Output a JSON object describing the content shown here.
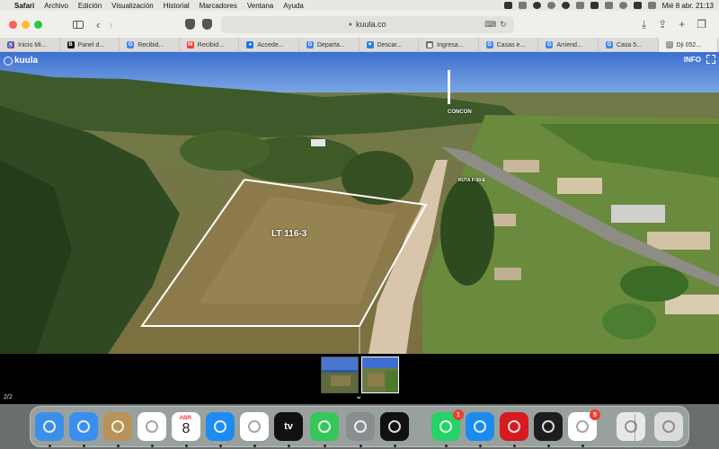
{
  "menubar": {
    "app": "Safari",
    "menus": [
      "Archivo",
      "Edición",
      "Visualización",
      "Historial",
      "Marcadores",
      "Ventana",
      "Ayuda"
    ],
    "datetime": "Mié 8 abr.  21:13"
  },
  "toolbar": {
    "url": "kuula.co"
  },
  "tabs": [
    {
      "label": "Inicio Mi...",
      "favicon_color": "#e0413f",
      "glyph": "♿"
    },
    {
      "label": "Panel d...",
      "favicon_color": "#111111",
      "glyph": "B"
    },
    {
      "label": "Recibid...",
      "favicon_color": "#4285f4",
      "glyph": "G"
    },
    {
      "label": "Recibid...",
      "favicon_color": "#ea4335",
      "glyph": "M"
    },
    {
      "label": "Accede...",
      "favicon_color": "#1a73e8",
      "glyph": "●"
    },
    {
      "label": "Departa...",
      "favicon_color": "#4285f4",
      "glyph": "G"
    },
    {
      "label": "Descar...",
      "favicon_color": "#2b7de9",
      "glyph": "♥"
    },
    {
      "label": "Ingresa...",
      "favicon_color": "#666666",
      "glyph": "▣"
    },
    {
      "label": "Casas e...",
      "favicon_color": "#4285f4",
      "glyph": "G"
    },
    {
      "label": "Arriend...",
      "favicon_color": "#4285f4",
      "glyph": "G"
    },
    {
      "label": "Casa 5...",
      "favicon_color": "#4285f4",
      "glyph": "G"
    },
    {
      "label": "Dji 052...",
      "favicon_color": "#999999",
      "glyph": "□",
      "active": true
    }
  ],
  "viewer": {
    "logo": "kuula",
    "info_label": "INFO",
    "lot_label": "LT 116-3",
    "landmark_label": "CONCON",
    "road_label": "RUTA F-30-E",
    "counter": "2/2"
  },
  "dock": {
    "apps": [
      {
        "name": "Finder",
        "icon": "finder-icon",
        "color": "#3b8fe8"
      },
      {
        "name": "Mail",
        "icon": "mail-icon",
        "color": "#3a8ef0"
      },
      {
        "name": "Contacts",
        "icon": "contacts-icon",
        "color": "#b8935a"
      },
      {
        "name": "Photos",
        "icon": "photos-icon",
        "color": "#ffffff"
      },
      {
        "name": "Calendar",
        "icon": "calendar-icon",
        "color": "#ffffff",
        "month": "ABR.",
        "day": "8"
      },
      {
        "name": "App Store",
        "icon": "app-store-icon",
        "color": "#1c8cf2"
      },
      {
        "name": "Reminders",
        "icon": "reminders-icon",
        "color": "#ffffff"
      },
      {
        "name": "TV",
        "icon": "tv-icon",
        "color": "#111111",
        "text": "tv"
      },
      {
        "name": "Messages",
        "icon": "messages-icon",
        "color": "#34c759"
      },
      {
        "name": "System Settings",
        "icon": "settings-icon",
        "color": "#8a8d90"
      },
      {
        "name": "Spotify",
        "icon": "spotify-icon",
        "color": "#111111"
      },
      {
        "name": "WhatsApp",
        "icon": "whatsapp-icon",
        "color": "#25d366",
        "badge": "1"
      },
      {
        "name": "Safari",
        "icon": "safari-icon",
        "color": "#1a8cf0"
      },
      {
        "name": "Acrobat",
        "icon": "acrobat-icon",
        "color": "#d71a20"
      },
      {
        "name": "Activity Monitor",
        "icon": "activity-monitor-icon",
        "color": "#1d1d1f"
      },
      {
        "name": "Microsoft",
        "icon": "microsoft-icon",
        "color": "#ffffff",
        "badge": "5"
      },
      {
        "name": "Preview",
        "icon": "preview-icon",
        "color": "#e8e8e8"
      },
      {
        "name": "Trash",
        "icon": "trash-icon",
        "color": "#dcdcdc"
      }
    ]
  }
}
